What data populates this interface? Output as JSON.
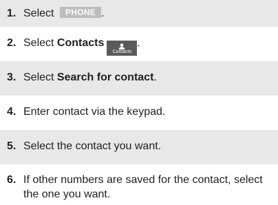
{
  "steps": [
    {
      "number": "1.",
      "text_before": "Select",
      "button_label": "PHONE",
      "text_after": "."
    },
    {
      "number": "2.",
      "text_before": "Select",
      "bold_text": "Contacts",
      "icon_label": "Contacts",
      "icon": "person-icon",
      "text_after": "."
    },
    {
      "number": "3.",
      "text_before": "Select",
      "bold_text": "Search for contact",
      "text_after": "."
    },
    {
      "number": "4.",
      "text": "Enter contact via the keypad."
    },
    {
      "number": "5.",
      "text": "Select the contact you want."
    },
    {
      "number": "6.",
      "text": "If other numbers are saved for the contact, select the one you want."
    }
  ],
  "colors": {
    "row_shade": "#e8e8e8",
    "phone_button_bg": "#bdbdbd",
    "contacts_icon_bg": "#5a5a5a"
  }
}
